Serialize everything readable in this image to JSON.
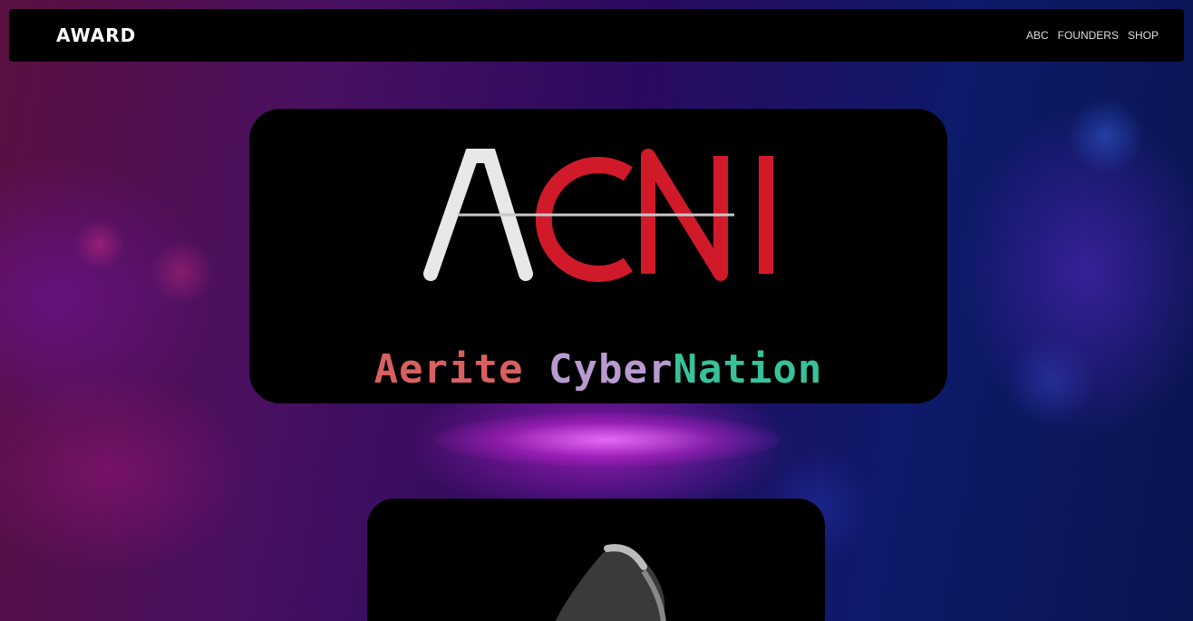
{
  "navbar": {
    "logo": "AWARD",
    "links": [
      {
        "label": "ABC"
      },
      {
        "label": "FOUNDERS"
      },
      {
        "label": "SHOP"
      }
    ]
  },
  "hero": {
    "logo_letters": "ACN",
    "logo_tagline": "",
    "title_part1": "Aerite",
    "title_part2": "Cyber",
    "title_part3": "Nation"
  },
  "colors": {
    "title_part1": "#d86060",
    "title_part2": "#b99ad0",
    "title_part3": "#37c29a",
    "logo_red": "#d01a2a",
    "logo_white": "#e8e8e8"
  },
  "icons": {
    "logo": "acn-logo-icon",
    "figure": "figure-image"
  }
}
